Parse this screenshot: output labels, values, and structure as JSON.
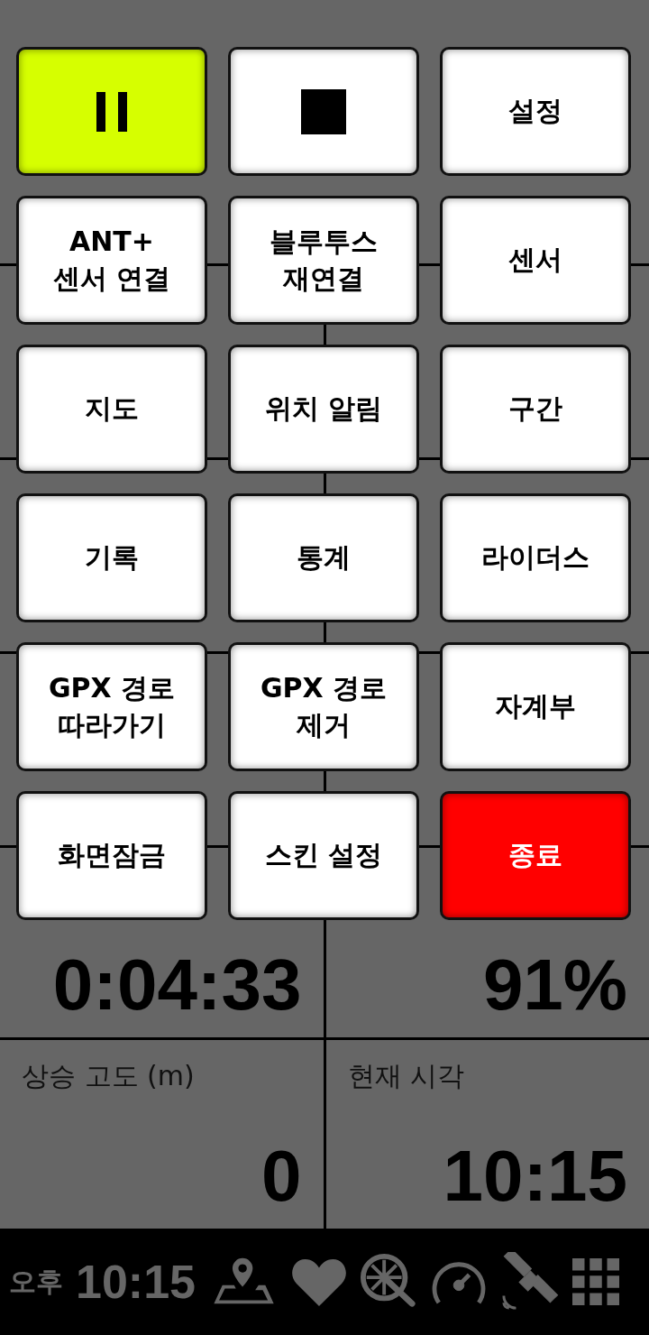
{
  "dashboard": {
    "cells": [
      {
        "value": "0:04:33"
      },
      {
        "value": "91%"
      },
      {
        "label": "상승 고도 (m)",
        "value": "0"
      },
      {
        "label": "현재 시각",
        "value": "10:15"
      }
    ]
  },
  "menu": {
    "buttons": [
      {
        "kind": "pause",
        "color": "#d6ff00"
      },
      {
        "kind": "stop",
        "color": "#ffffff"
      },
      {
        "kind": "text",
        "color": "#ffffff",
        "label": "설정"
      },
      {
        "kind": "text",
        "color": "#ffffff",
        "label": "ANT+\n센서 연결"
      },
      {
        "kind": "text",
        "color": "#ffffff",
        "label": "블루투스\n재연결"
      },
      {
        "kind": "text",
        "color": "#ffffff",
        "label": "센서"
      },
      {
        "kind": "text",
        "color": "#ffffff",
        "label": "지도"
      },
      {
        "kind": "text",
        "color": "#ffffff",
        "label": "위치 알림"
      },
      {
        "kind": "text",
        "color": "#ffffff",
        "label": "구간"
      },
      {
        "kind": "text",
        "color": "#ffffff",
        "label": "기록"
      },
      {
        "kind": "text",
        "color": "#ffffff",
        "label": "통계"
      },
      {
        "kind": "text",
        "color": "#ffffff",
        "label": "라이더스"
      },
      {
        "kind": "text",
        "color": "#ffffff",
        "label": "GPX 경로\n따라가기"
      },
      {
        "kind": "text",
        "color": "#ffffff",
        "label": "GPX 경로\n제거"
      },
      {
        "kind": "text",
        "color": "#ffffff",
        "label": "자계부"
      },
      {
        "kind": "text",
        "color": "#ffffff",
        "label": "화면잠금"
      },
      {
        "kind": "text",
        "color": "#ffffff",
        "label": "스킨 설정"
      },
      {
        "kind": "text",
        "color": "#ff0000",
        "label": "종료"
      }
    ]
  },
  "status_bar": {
    "period": "오후",
    "time": "10:15"
  }
}
